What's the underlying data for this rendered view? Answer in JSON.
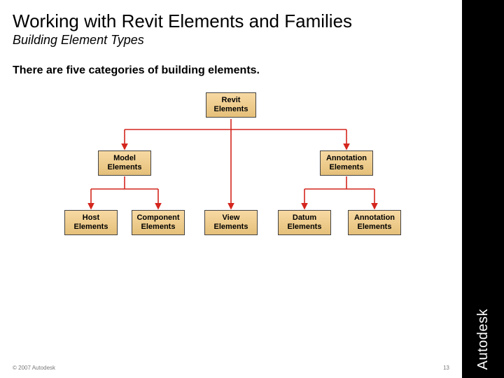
{
  "sidebar": {
    "brand": "Autodesk"
  },
  "title": "Working with Revit Elements and Families",
  "subtitle": "Building Element Types",
  "description": "There are five categories of building elements.",
  "chart_data": {
    "type": "tree",
    "root": {
      "label": "Revit\nElements",
      "children": [
        {
          "label": "Model\nElements",
          "children": [
            {
              "label": "Host\nElements"
            },
            {
              "label": "Component\nElements"
            }
          ]
        },
        {
          "label": "View\nElements"
        },
        {
          "label": "Annotation\nElements",
          "children": [
            {
              "label": "Datum\nElements"
            },
            {
              "label": "Annotation\nElements"
            }
          ]
        }
      ]
    },
    "node_fill": "#f3cd8c",
    "connector_color": "#d4261e"
  },
  "nodes": {
    "root": "Revit\nElements",
    "mid_left": "Model\nElements",
    "mid_right": "Annotation\nElements",
    "leaf_0": "Host\nElements",
    "leaf_1": "Component\nElements",
    "leaf_2": "View\nElements",
    "leaf_3": "Datum\nElements",
    "leaf_4": "Annotation\nElements"
  },
  "footer": {
    "copyright": "© 2007 Autodesk",
    "page_number": "13"
  }
}
